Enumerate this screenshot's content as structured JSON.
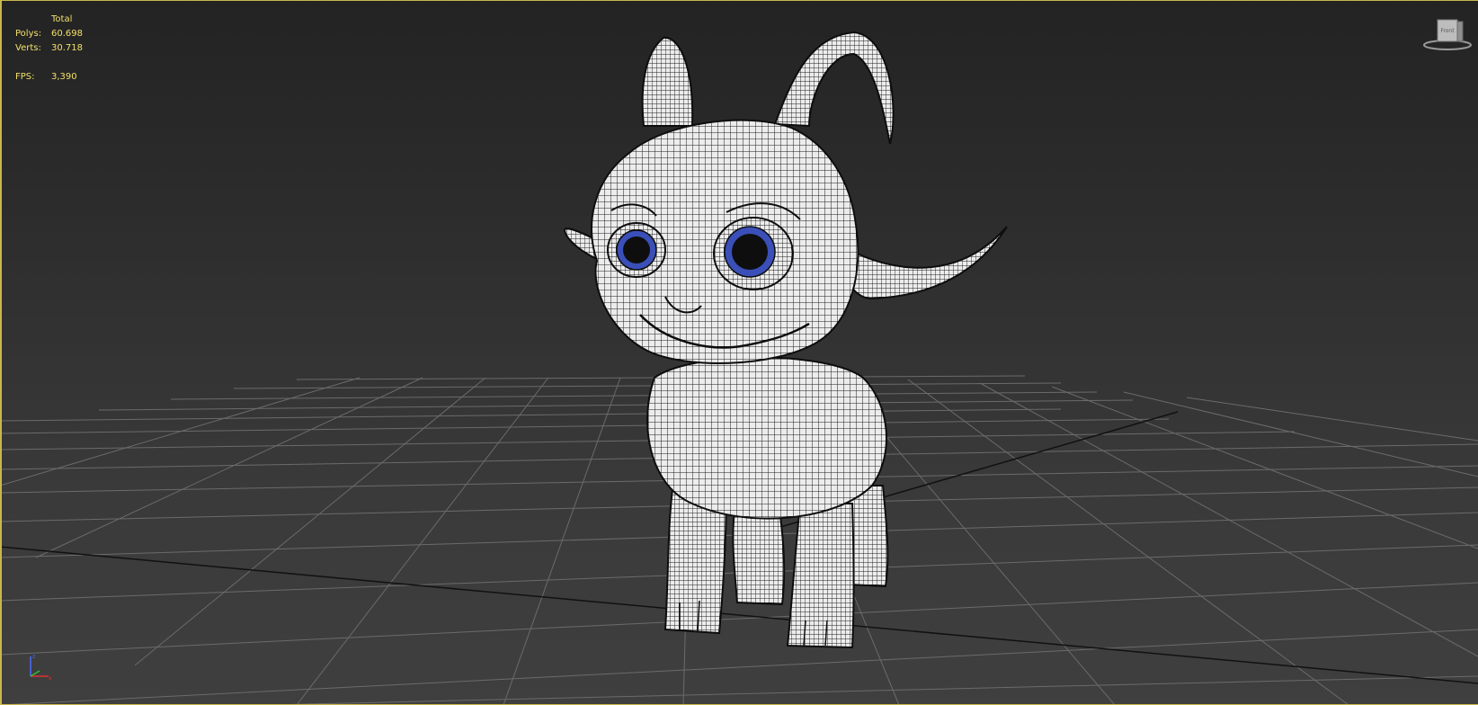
{
  "viewport": {
    "stats": {
      "header": "Total",
      "polys_label": "Polys:",
      "polys_value": "60.698",
      "verts_label": "Verts:",
      "verts_value": "30.718",
      "fps_label": "FPS:",
      "fps_value": "3,390"
    },
    "viewcube": {
      "face_label": "Front"
    },
    "colors": {
      "stats_text": "#f2e06a",
      "viewport_border": "#c9b74a",
      "grid_line": "#6a6a6a",
      "grid_axis": "#111111",
      "model_fill": "#e8e8e8",
      "wire": "#1a1a1a",
      "iris": "#3a4fb8"
    },
    "model": {
      "name_icon": "goat-mesh-model"
    }
  }
}
